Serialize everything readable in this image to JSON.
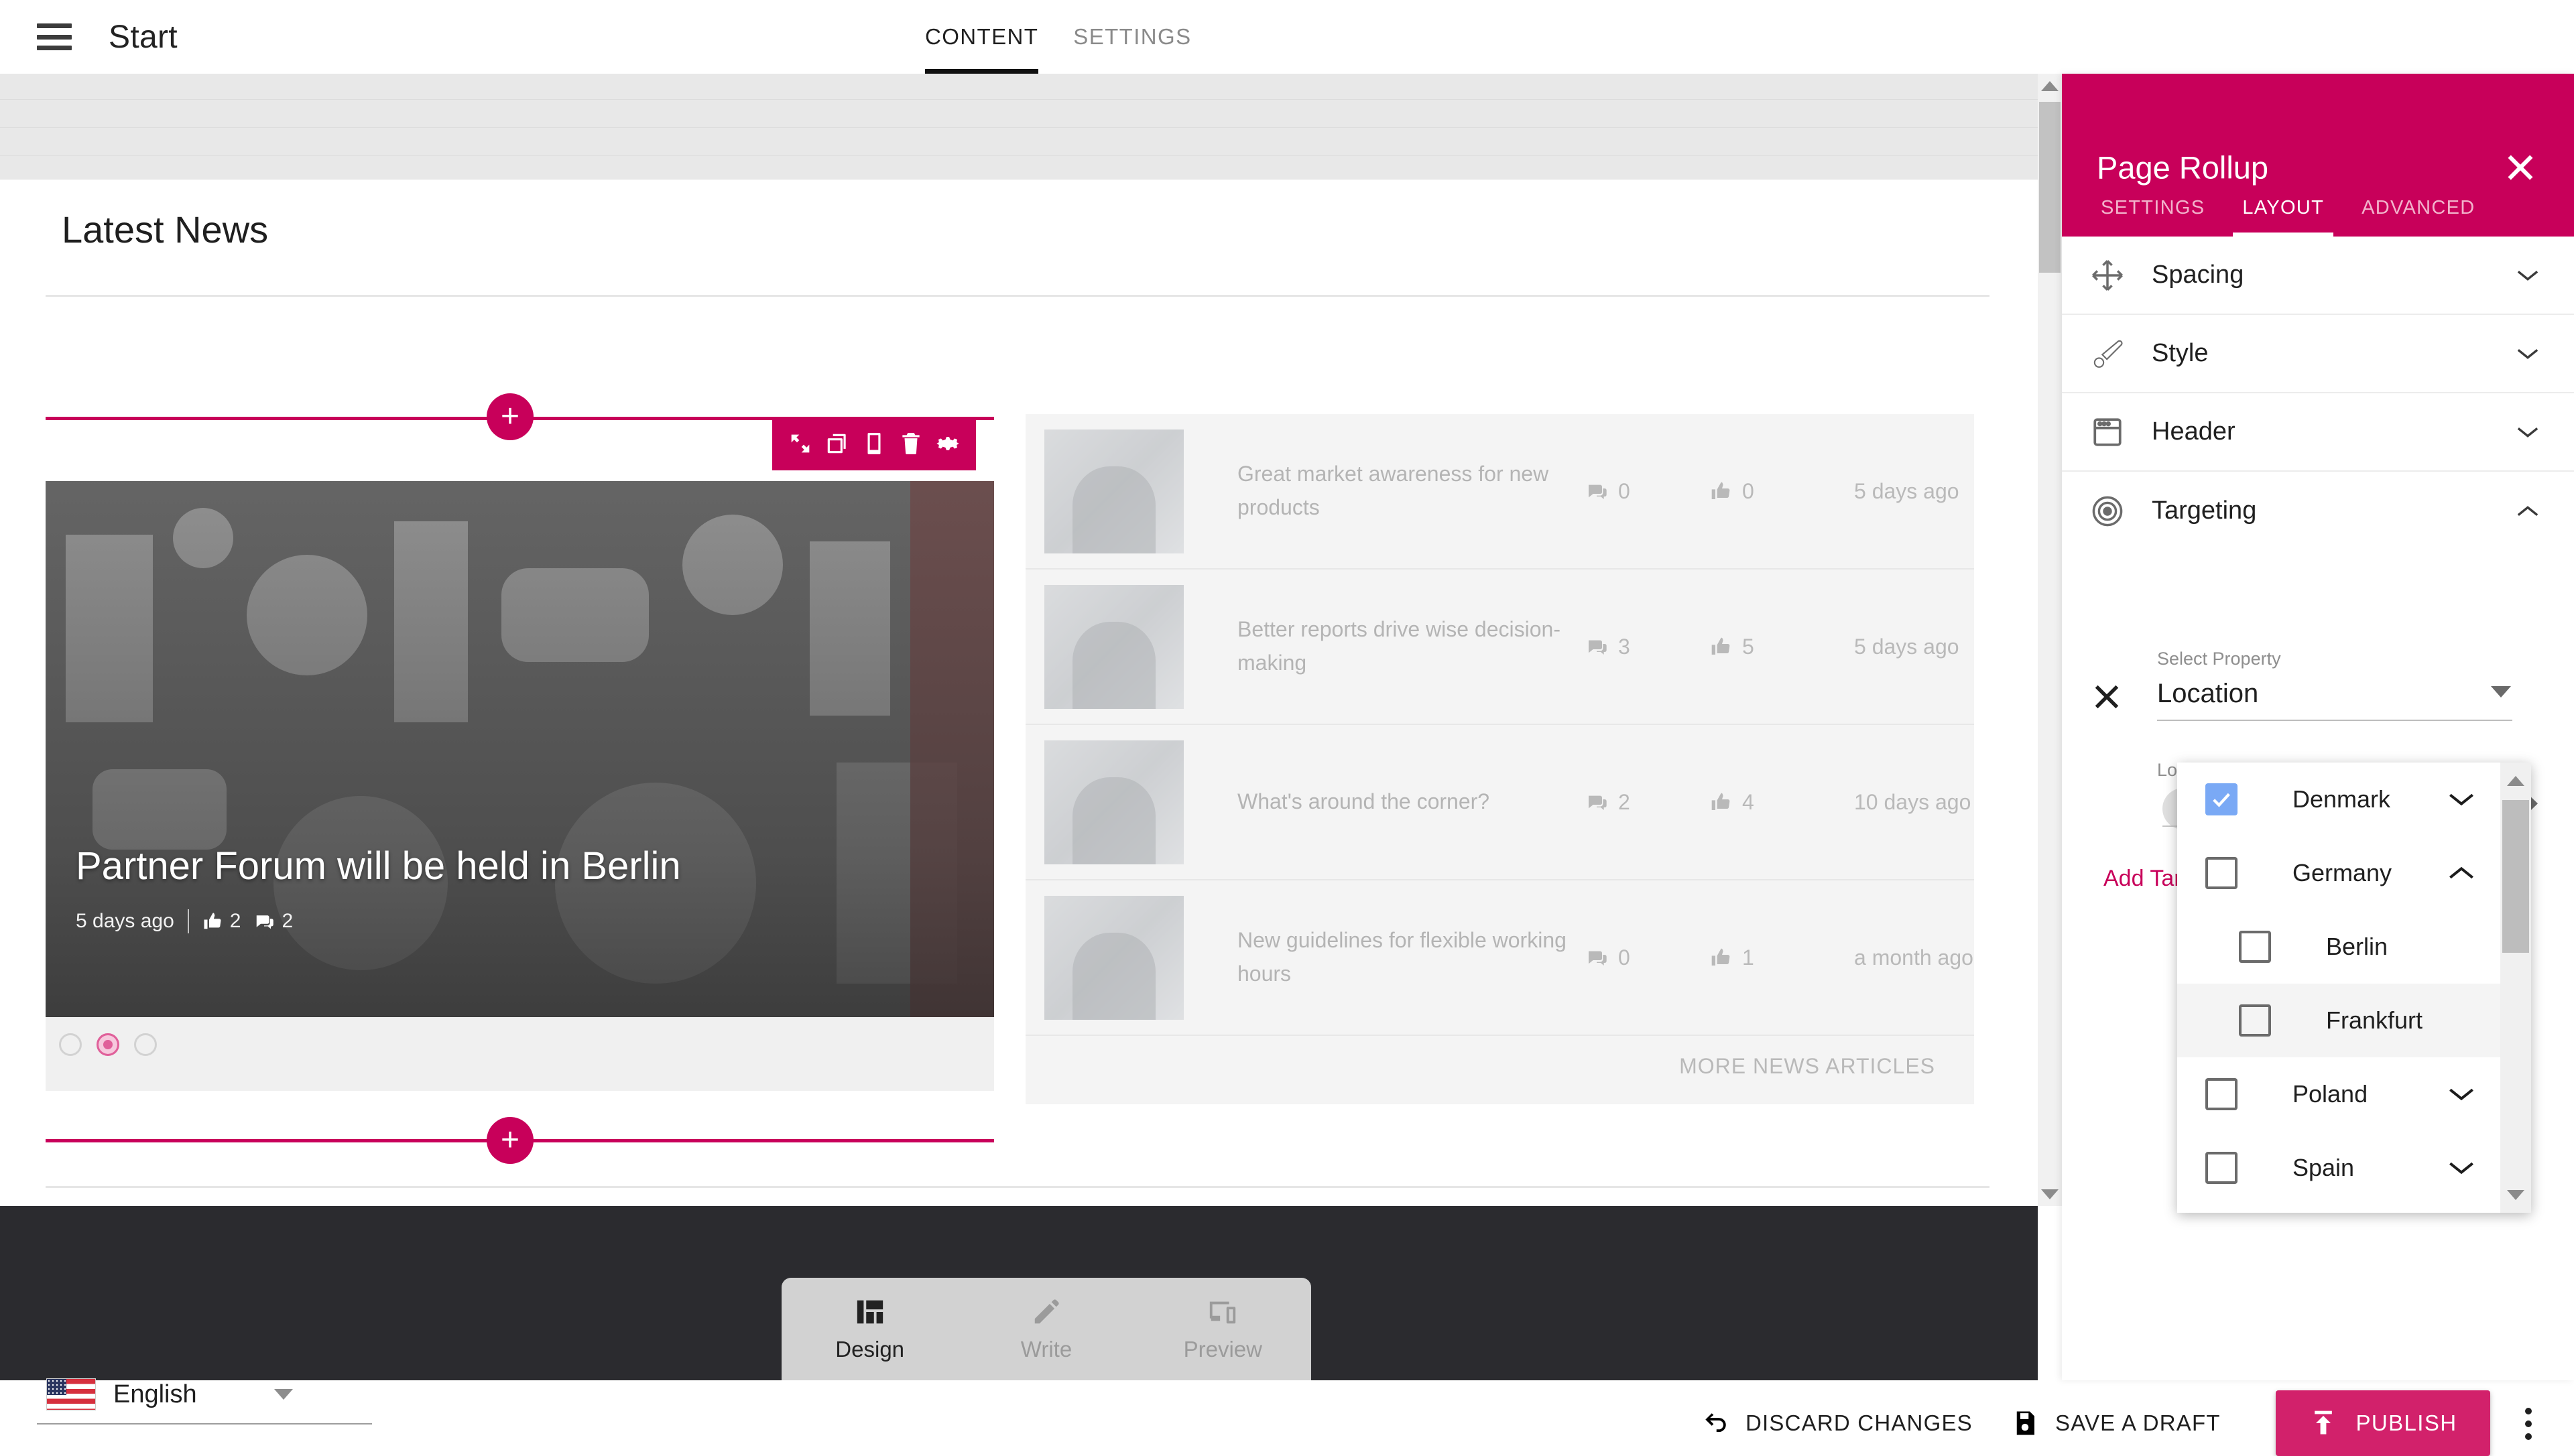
{
  "app": {
    "title": "Start",
    "menu_icon": "hamburger-icon",
    "tabs": [
      {
        "label": "CONTENT",
        "active": true
      },
      {
        "label": "SETTINGS",
        "active": false
      }
    ]
  },
  "canvas": {
    "section_title": "Latest News",
    "hero": {
      "headline": "Partner Forum will be held in Berlin",
      "date": "5 days ago",
      "likes": "2",
      "comments": "2",
      "toolbar": [
        {
          "icon": "expand-icon",
          "name": "expand-block-button"
        },
        {
          "icon": "copy-icon",
          "name": "duplicate-block-button"
        },
        {
          "icon": "mobile-icon",
          "name": "mobile-view-button"
        },
        {
          "icon": "trash-icon",
          "name": "delete-block-button"
        },
        {
          "icon": "gear-icon",
          "name": "block-settings-button"
        }
      ],
      "carousel_dots": 3,
      "active_dot_index": 1
    },
    "news": {
      "items": [
        {
          "title": "Great market awareness for new products",
          "comments": "0",
          "likes": "0",
          "date": "5 days ago"
        },
        {
          "title": "Better reports drive wise decision-making",
          "comments": "3",
          "likes": "5",
          "date": "5 days ago"
        },
        {
          "title": "What's around the corner?",
          "comments": "2",
          "likes": "4",
          "date": "10 days ago"
        },
        {
          "title": "New guidelines for flexible working hours",
          "comments": "0",
          "likes": "1",
          "date": "a month ago"
        }
      ],
      "more_label": "MORE NEWS ARTICLES"
    },
    "add_block_label": "+"
  },
  "mode_switch": {
    "items": [
      {
        "label": "Design",
        "icon": "layout-icon",
        "active": true
      },
      {
        "label": "Write",
        "icon": "pencil-icon",
        "active": false
      },
      {
        "label": "Preview",
        "icon": "devices-icon",
        "active": false
      }
    ]
  },
  "bottom_bar": {
    "language": "English",
    "language_flag": "us-flag-icon",
    "discard_label": "DISCARD CHANGES",
    "save_label": "SAVE A DRAFT",
    "publish_label": "PUBLISH",
    "overflow_icon": "kebab-menu-icon"
  },
  "panel": {
    "title": "Page Rollup",
    "close_icon": "close-icon",
    "tabs": [
      {
        "label": "SETTINGS",
        "active": false
      },
      {
        "label": "LAYOUT",
        "active": true
      },
      {
        "label": "ADVANCED",
        "active": false
      }
    ],
    "accordions": [
      {
        "label": "Spacing",
        "icon": "move-icon",
        "expanded": false
      },
      {
        "label": "Style",
        "icon": "brush-icon",
        "expanded": false
      },
      {
        "label": "Header",
        "icon": "header-icon",
        "expanded": false
      },
      {
        "label": "Targeting",
        "icon": "target-icon",
        "expanded": true
      }
    ],
    "targeting": {
      "select_property_label": "Select Property",
      "selected_property": "Location",
      "clear_icon": "close-icon",
      "location_label": "Location",
      "chips": [
        {
          "label": "Denmark",
          "remove_icon": "close-icon"
        }
      ],
      "tag_icon": "tag-icon",
      "add_targeting_label": "Add Targ",
      "dropdown": {
        "options": [
          {
            "label": "Denmark",
            "checked": true,
            "expandable": true,
            "expanded": false,
            "indent": 0,
            "highlighted": false
          },
          {
            "label": "Germany",
            "checked": false,
            "expandable": true,
            "expanded": true,
            "indent": 0,
            "highlighted": false
          },
          {
            "label": "Berlin",
            "checked": false,
            "expandable": false,
            "expanded": false,
            "indent": 1,
            "highlighted": false
          },
          {
            "label": "Frankfurt",
            "checked": false,
            "expandable": false,
            "expanded": false,
            "indent": 1,
            "highlighted": true
          },
          {
            "label": "Poland",
            "checked": false,
            "expandable": true,
            "expanded": false,
            "indent": 0,
            "highlighted": false
          },
          {
            "label": "Spain",
            "checked": false,
            "expandable": true,
            "expanded": false,
            "indent": 0,
            "highlighted": false
          }
        ]
      }
    }
  },
  "colors": {
    "brand_pink": "#c8005a",
    "publish_pink": "#d2216b",
    "checkbox_blue": "#7aa9f5",
    "dark_footer": "#2b2b2f"
  }
}
